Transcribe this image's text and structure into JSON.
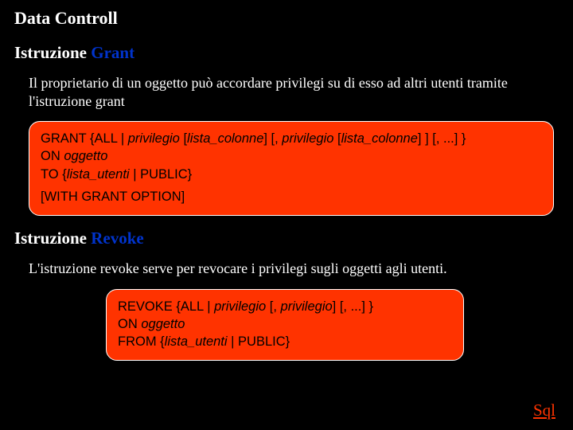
{
  "page_title": "Data Controll",
  "grant": {
    "heading_prefix": "Istruzione ",
    "heading_keyword": "Grant",
    "body": "Il proprietario di un oggetto può accordare privilegi su di esso ad altri utenti tramite l'istruzione grant",
    "syntax": {
      "l1_a": " GRANT {ALL | ",
      "l1_b": "privilegio",
      "l1_c": " [",
      "l1_d": "lista_colonne",
      "l1_e": "] [, ",
      "l1_f": "privilegio",
      "l1_g": " [",
      "l1_h": "lista_colonne",
      "l1_i": "] ] [, ...] }",
      "l2_a": "ON ",
      "l2_b": "oggetto",
      "l3_a": "TO {",
      "l3_b": "lista_utenti",
      "l3_c": " | PUBLIC}",
      "l4": "[WITH GRANT OPTION]"
    }
  },
  "revoke": {
    "heading_prefix": "Istruzione ",
    "heading_keyword": "Revoke",
    "body": "L'istruzione revoke  serve per revocare i privilegi sugli oggetti agli utenti.",
    "syntax": {
      "l1_a": "REVOKE {ALL | ",
      "l1_b": "privilegio",
      "l1_c": " [, ",
      "l1_d": "privilegio",
      "l1_e": "] [, ...] }",
      "l2_a": "ON ",
      "l2_b": "oggetto",
      "l3_a": "FROM {",
      "l3_b": "lista_utenti",
      "l3_c": " | PUBLIC}"
    }
  },
  "bottom_link": "Sql"
}
